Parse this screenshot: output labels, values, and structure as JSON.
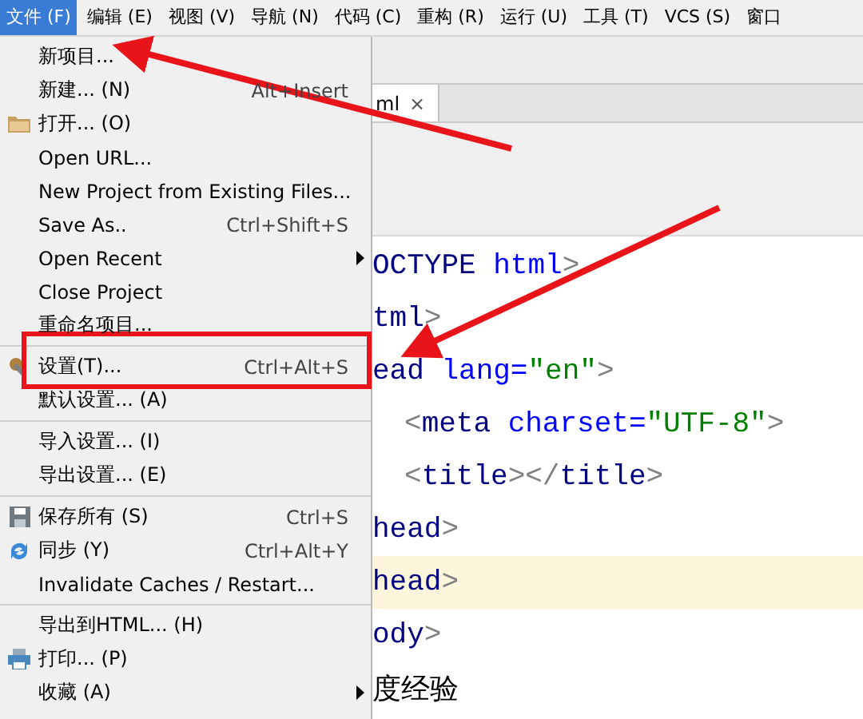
{
  "menu_bar": [
    {
      "label": "文件 (F)",
      "selected": true
    },
    {
      "label": "编辑 (E)",
      "selected": false
    },
    {
      "label": "视图 (V)",
      "selected": false
    },
    {
      "label": "导航 (N)",
      "selected": false
    },
    {
      "label": "代码 (C)",
      "selected": false
    },
    {
      "label": "重构 (R)",
      "selected": false
    },
    {
      "label": "运行 (U)",
      "selected": false
    },
    {
      "label": "工具 (T)",
      "selected": false
    },
    {
      "label": "VCS (S)",
      "selected": false
    },
    {
      "label": "窗口",
      "selected": false
    }
  ],
  "file_menu": [
    {
      "kind": "item",
      "label": "新项目..."
    },
    {
      "kind": "item",
      "label": "新建... (N)",
      "shortcut": "Alt+Insert"
    },
    {
      "kind": "item",
      "label": "打开... (O)"
    },
    {
      "kind": "item",
      "label": "Open URL..."
    },
    {
      "kind": "item",
      "label": "New Project from Existing Files..."
    },
    {
      "kind": "item",
      "label": "Save As..",
      "shortcut": "Ctrl+Shift+S"
    },
    {
      "kind": "item",
      "label": "Open Recent",
      "submenu": true
    },
    {
      "kind": "item",
      "label": "Close Project"
    },
    {
      "kind": "item",
      "label": "重命名项目..."
    },
    {
      "kind": "separator"
    },
    {
      "kind": "item",
      "label": "设置(T)...",
      "shortcut": "Ctrl+Alt+S"
    },
    {
      "kind": "item",
      "label": "默认设置... (A)"
    },
    {
      "kind": "separator"
    },
    {
      "kind": "item",
      "label": "导入设置... (I)"
    },
    {
      "kind": "item",
      "label": "导出设置... (E)"
    },
    {
      "kind": "separator"
    },
    {
      "kind": "item",
      "label": "保存所有 (S)",
      "shortcut": "Ctrl+S"
    },
    {
      "kind": "item",
      "label": "同步 (Y)",
      "shortcut": "Ctrl+Alt+Y"
    },
    {
      "kind": "item",
      "label": "Invalidate Caches / Restart..."
    },
    {
      "kind": "separator"
    },
    {
      "kind": "item",
      "label": "导出到HTML... (H)"
    },
    {
      "kind": "item",
      "label": "打印... (P)"
    },
    {
      "kind": "item",
      "label": "收藏 (A)",
      "submenu": true
    }
  ],
  "editor": {
    "tab": {
      "label": "ml",
      "close": "×"
    },
    "lines": [
      {
        "indent": false,
        "current": false,
        "tokens": [
          {
            "kind": "tag",
            "text": "OCTYPE "
          },
          {
            "kind": "attr",
            "text": "html"
          },
          {
            "kind": "punct",
            "text": ">"
          }
        ]
      },
      {
        "indent": false,
        "current": false,
        "tokens": [
          {
            "kind": "tag",
            "text": "tml"
          },
          {
            "kind": "punct",
            "text": ">"
          }
        ]
      },
      {
        "indent": false,
        "current": false,
        "tokens": [
          {
            "kind": "tag",
            "text": "ead "
          },
          {
            "kind": "attr",
            "text": "lang="
          },
          {
            "kind": "value",
            "text": "\"en\""
          },
          {
            "kind": "punct",
            "text": ">"
          }
        ]
      },
      {
        "indent": true,
        "current": false,
        "tokens": [
          {
            "kind": "punct",
            "text": "<"
          },
          {
            "kind": "tag",
            "text": "meta "
          },
          {
            "kind": "attr",
            "text": "charset="
          },
          {
            "kind": "value",
            "text": "\"UTF-8\""
          },
          {
            "kind": "punct",
            "text": ">"
          }
        ]
      },
      {
        "indent": true,
        "current": false,
        "tokens": [
          {
            "kind": "punct",
            "text": "<"
          },
          {
            "kind": "tag",
            "text": "title"
          },
          {
            "kind": "punct",
            "text": "></"
          },
          {
            "kind": "tag",
            "text": "title"
          },
          {
            "kind": "punct",
            "text": ">"
          }
        ]
      },
      {
        "indent": false,
        "current": false,
        "tokens": [
          {
            "kind": "tag",
            "text": "head"
          },
          {
            "kind": "punct",
            "text": ">"
          }
        ]
      },
      {
        "indent": false,
        "current": true,
        "tokens": [
          {
            "kind": "tag",
            "text": "head"
          },
          {
            "kind": "punct",
            "text": ">"
          }
        ]
      },
      {
        "indent": false,
        "current": false,
        "tokens": [
          {
            "kind": "tag",
            "text": "ody"
          },
          {
            "kind": "punct",
            "text": ">"
          }
        ]
      },
      {
        "indent": false,
        "current": false,
        "tokens": [
          {
            "kind": "text",
            "text": "度经验"
          }
        ]
      }
    ]
  }
}
